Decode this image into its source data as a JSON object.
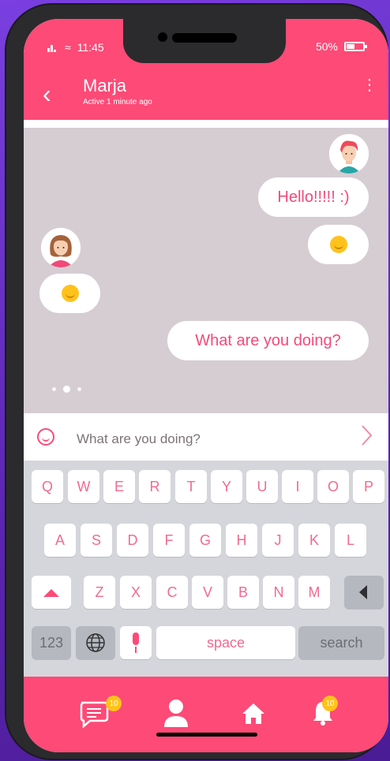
{
  "status": {
    "time": "11:45",
    "battery": "50%",
    "battery_fraction": 0.5
  },
  "header": {
    "name": "Marja",
    "status": "Active 1 minute ago"
  },
  "chat": {
    "messages": [
      {
        "from": "me",
        "text": "Hello!!!!! :)"
      },
      {
        "from": "me",
        "emoji": "smile-emoji"
      },
      {
        "from": "other",
        "emoji": "smile-emoji"
      },
      {
        "from": "me",
        "text": "What are you doing?"
      }
    ]
  },
  "input": {
    "value": "What are you doing?"
  },
  "keyboard": {
    "row1": [
      "Q",
      "W",
      "E",
      "R",
      "T",
      "Y",
      "U",
      "I",
      "O",
      "P"
    ],
    "row2": [
      "A",
      "S",
      "D",
      "F",
      "G",
      "H",
      "J",
      "K",
      "L"
    ],
    "row3": [
      "Z",
      "X",
      "C",
      "V",
      "B",
      "N",
      "M"
    ],
    "numbers": "123",
    "space": "space",
    "search": "search"
  },
  "nav": {
    "messages_badge": "10",
    "notifications_badge": "10"
  },
  "colors": {
    "accent": "#fd4a77",
    "chat_bg": "#d6cdd3",
    "emoji": "#ffc21c"
  }
}
